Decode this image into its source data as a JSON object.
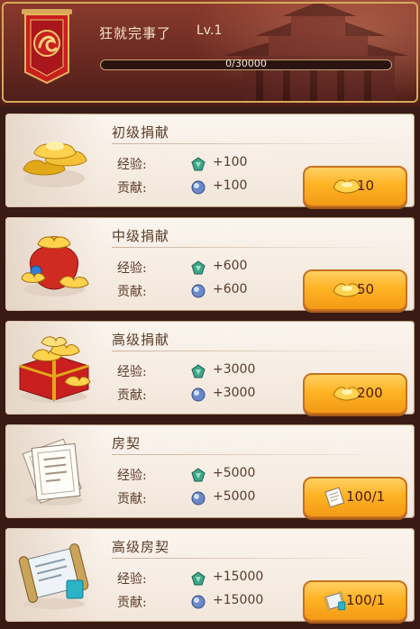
{
  "header": {
    "player_name": "狂就完事了",
    "level": "Lv.1",
    "xp_text": "0/30000",
    "xp_fraction": 0.0
  },
  "donations": [
    {
      "title": "初级捐献",
      "exp_label": "经验:",
      "exp_value": "+100",
      "contrib_label": "贡献:",
      "contrib_value": "+100",
      "cost": "10",
      "cost_icon": "gold-ingot-icon"
    },
    {
      "title": "中级捐献",
      "exp_label": "经验:",
      "exp_value": "+600",
      "contrib_label": "贡献:",
      "contrib_value": "+600",
      "cost": "50",
      "cost_icon": "gold-ingot-icon"
    },
    {
      "title": "高级捐献",
      "exp_label": "经验:",
      "exp_value": "+3000",
      "contrib_label": "贡献:",
      "contrib_value": "+3000",
      "cost": "200",
      "cost_icon": "gold-ingot-icon"
    },
    {
      "title": "房契",
      "exp_label": "经验:",
      "exp_value": "+5000",
      "contrib_label": "贡献:",
      "contrib_value": "+5000",
      "cost": "100/1",
      "cost_icon": "deed-icon"
    },
    {
      "title": "高级房契",
      "exp_label": "经验:",
      "exp_value": "+15000",
      "contrib_label": "贡献:",
      "contrib_value": "+15000",
      "cost": "100/1",
      "cost_icon": "advanced-deed-icon"
    }
  ]
}
